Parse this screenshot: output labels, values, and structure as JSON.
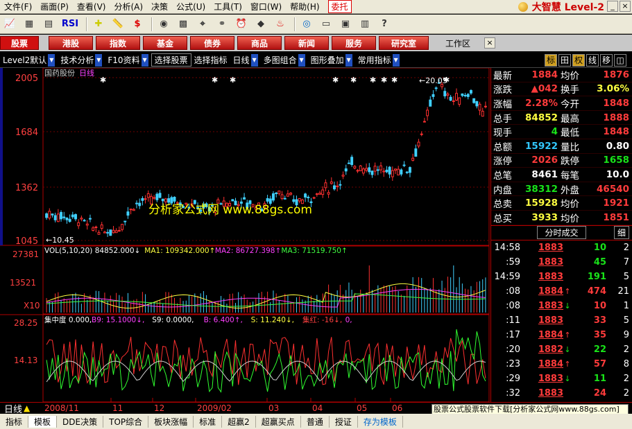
{
  "menu": [
    "文件(F)",
    "画面(P)",
    "查看(V)",
    "分析(A)",
    "决策",
    "公式(U)",
    "工具(T)",
    "窗口(W)",
    "帮助(H)"
  ],
  "menu_weituo": "委托",
  "brand": "大智慧 Level-2",
  "toolbar_icons": [
    "chart-icon",
    "grid-icon",
    "bar-chart-icon",
    "rsi-icon",
    "crosshair-icon",
    "ruler-icon",
    "dollar-icon",
    "indicator-icon",
    "grid2-icon",
    "scan-icon",
    "binoculars-icon",
    "alarm-icon",
    "arrow-icon",
    "fire-icon",
    "eye-icon",
    "news-icon",
    "calendar-icon",
    "books-icon",
    "help-pointer-icon"
  ],
  "toolbar_labels": {
    "rsi": "RSI"
  },
  "nav": {
    "items": [
      "股票",
      "港股",
      "指数",
      "基金",
      "债券",
      "商品",
      "新闻",
      "服务",
      "研究室"
    ],
    "workspace": "工作区",
    "close": "×"
  },
  "subbar": {
    "items": [
      "Level2默认",
      "技术分析",
      "F10资料",
      "选择股票",
      "选择指标",
      "日线",
      "多图组合",
      "图形叠加",
      "常用指标"
    ],
    "tabs": [
      "标",
      "田",
      "权",
      "线",
      "移",
      "◫"
    ]
  },
  "chart": {
    "stock": "国药股份",
    "period": "日线",
    "price_ticks": [
      "2005",
      "1684",
      "1362",
      "1045"
    ],
    "high_label": "20.05",
    "low_label": "10.45",
    "watermark": "分析家公式网  www.88gs.com",
    "vol_ticks": [
      "27381",
      "13521",
      "X10"
    ],
    "vol_legend": [
      {
        "text": "VOL(5,10,20) 84852.000↓",
        "color": "#ffffff"
      },
      {
        "text": "MA1: 109342.000↑",
        "color": "#ffff40"
      },
      {
        "text": "MA2: 86727.398↑",
        "color": "#ff40ff"
      },
      {
        "text": "MA3: 71519.750↑",
        "color": "#40ff40"
      }
    ],
    "ind_ticks": [
      "28.25",
      "14.13"
    ],
    "ind_legend": [
      {
        "text": "集中度 0.000,",
        "color": "#ffffff"
      },
      {
        "text": "B9: 15.1000↓,",
        "color": "#ff40ff"
      },
      {
        "text": "S9: 0.0000,",
        "color": "#ffffff"
      },
      {
        "text": "B: 6.400↑,",
        "color": "#ff40ff"
      },
      {
        "text": "S: 11.240↓,",
        "color": "#ffff40"
      },
      {
        "text": "集红: -16↓,",
        "color": "#ff4040"
      },
      {
        "text": "0,",
        "color": "#ff40ff"
      }
    ],
    "date_labels": [
      "2008/11",
      "11",
      "12",
      "2009/02",
      "03",
      "04",
      "05",
      "06"
    ],
    "bottom_left": "日线"
  },
  "quote": [
    {
      "l1": "最新",
      "v1": "1884",
      "c1": "red",
      "l2": "均价",
      "v2": "1876",
      "c2": "red"
    },
    {
      "l1": "涨跌",
      "v1": "▲042",
      "c1": "red",
      "l2": "换手",
      "v2": "3.06%",
      "c2": "yel"
    },
    {
      "l1": "涨幅",
      "v1": "2.28%",
      "c1": "red",
      "l2": "今开",
      "v2": "1848",
      "c2": "red"
    },
    {
      "l1": "总手",
      "v1": "84852",
      "c1": "yel",
      "l2": "最高",
      "v2": "1888",
      "c2": "red"
    },
    {
      "l1": "现手",
      "v1": "4",
      "c1": "green",
      "l2": "最低",
      "v2": "1848",
      "c2": "red"
    },
    {
      "l1": "总额",
      "v1": "15922",
      "c1": "cyan",
      "l2": "量比",
      "v2": "0.80",
      "c2": "white"
    },
    {
      "l1": "涨停",
      "v1": "2026",
      "c1": "red",
      "l2": "跌停",
      "v2": "1658",
      "c2": "green"
    },
    {
      "l1": "总笔",
      "v1": "8461",
      "c1": "white",
      "l2": "每笔",
      "v2": "10.0",
      "c2": "white"
    },
    {
      "l1": "内盘",
      "v1": "38312",
      "c1": "green",
      "l2": "外盘",
      "v2": "46540",
      "c2": "red"
    },
    {
      "l1": "总卖",
      "v1": "15928",
      "c1": "yel",
      "l2": "均价",
      "v2": "1921",
      "c2": "red"
    },
    {
      "l1": "总买",
      "v1": "3933",
      "c1": "yel",
      "l2": "均价",
      "v2": "1851",
      "c2": "red"
    }
  ],
  "ticks_head": {
    "label": "分时成交",
    "mini": "细"
  },
  "ticks": [
    {
      "t": "14:58",
      "p": "1883",
      "ar": "",
      "arc": "",
      "v": "10",
      "vc": "green",
      "n": "2"
    },
    {
      "t": ":59",
      "p": "1883",
      "ar": "",
      "arc": "",
      "v": "45",
      "vc": "green",
      "n": "7"
    },
    {
      "t": "14:59",
      "p": "1883",
      "ar": "",
      "arc": "",
      "v": "191",
      "vc": "green",
      "n": "5"
    },
    {
      "t": ":08",
      "p": "1884",
      "ar": "↑",
      "arc": "red",
      "v": "474",
      "vc": "red",
      "n": "21"
    },
    {
      "t": ":08",
      "p": "1883",
      "ar": "↓",
      "arc": "green",
      "v": "10",
      "vc": "red",
      "n": "1"
    },
    {
      "t": ":11",
      "p": "1883",
      "ar": "",
      "arc": "",
      "v": "33",
      "vc": "red",
      "n": "5"
    },
    {
      "t": ":17",
      "p": "1884",
      "ar": "↑",
      "arc": "red",
      "v": "35",
      "vc": "red",
      "n": "9"
    },
    {
      "t": ":20",
      "p": "1882",
      "ar": "↓",
      "arc": "green",
      "v": "22",
      "vc": "green",
      "n": "2"
    },
    {
      "t": ":23",
      "p": "1884",
      "ar": "↑",
      "arc": "red",
      "v": "57",
      "vc": "red",
      "n": "8"
    },
    {
      "t": ":29",
      "p": "1883",
      "ar": "↓",
      "arc": "green",
      "v": "11",
      "vc": "green",
      "n": "2"
    },
    {
      "t": ":32",
      "p": "1883",
      "ar": "",
      "arc": "",
      "v": "24",
      "vc": "red",
      "n": "2"
    }
  ],
  "banner": "股票公式股票软件下载[分析家公式网www.88gs.com]",
  "bottom_tabs": [
    "指标",
    "模板",
    "DDE决策",
    "TOP综合",
    "板块涨幅",
    "标准",
    "超赢2",
    "超赢买点",
    "普通",
    "授证",
    "存为模板"
  ]
}
